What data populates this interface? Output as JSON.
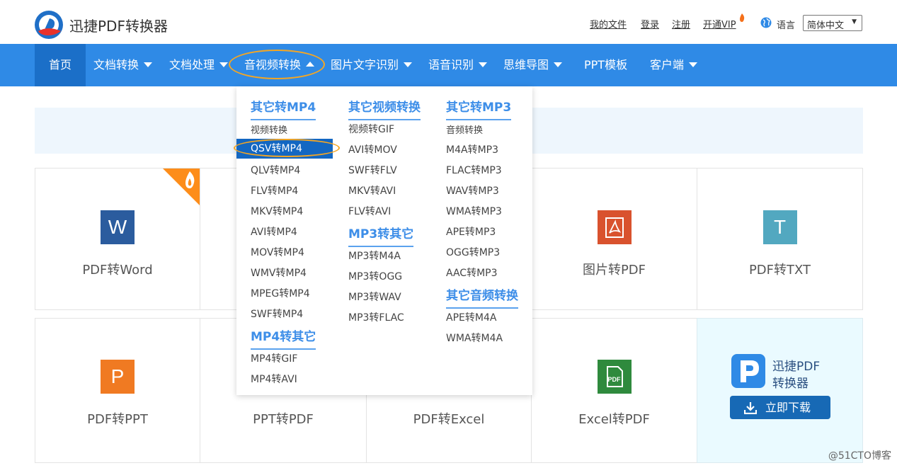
{
  "header": {
    "brand": "迅捷PDF转换器",
    "links": [
      "我的文件",
      "登录",
      "注册",
      "开通VIP"
    ],
    "lang_label": "语言",
    "lang_value": "简体中文"
  },
  "nav": {
    "items": [
      "首页",
      "文档转换",
      "文档处理",
      "音视频转换",
      "图片文字识别",
      "语音识别",
      "思维导图",
      "PPT模板",
      "客户端"
    ]
  },
  "dropdown": {
    "col1": {
      "title1": "其它转MP4",
      "items1": [
        "视频转换",
        "QSV转MP4",
        "QLV转MP4",
        "FLV转MP4",
        "MKV转MP4",
        "AVI转MP4",
        "MOV转MP4",
        "WMV转MP4",
        "MPEG转MP4",
        "SWF转MP4"
      ],
      "title2": "MP4转其它",
      "items2": [
        "MP4转GIF",
        "MP4转AVI"
      ]
    },
    "col2": {
      "title1": "其它视频转换",
      "items1": [
        "视频转GIF",
        "AVI转MOV",
        "SWF转FLV",
        "MKV转AVI",
        "FLV转AVI"
      ],
      "title2": "MP3转其它",
      "items2": [
        "MP3转M4A",
        "MP3转OGG",
        "MP3转WAV",
        "MP3转FLAC"
      ]
    },
    "col3": {
      "title1": "其它转MP3",
      "items1": [
        "音频转换",
        "M4A转MP3",
        "FLAC转MP3",
        "WAV转MP3",
        "WMA转MP3",
        "APE转MP3",
        "OGG转MP3",
        "AAC转MP3"
      ],
      "title2": "其它音频转换",
      "items2": [
        "APE转M4A",
        "WMA转M4A"
      ]
    }
  },
  "cards": {
    "row1": [
      {
        "icon": "W",
        "label": "PDF转Word",
        "color": "#2b5c9e"
      },
      {
        "icon": "",
        "label": "",
        "color": ""
      },
      {
        "icon": "",
        "label": "",
        "color": ""
      },
      {
        "icon": "pdf-acrobat-icon",
        "label": "图片转PDF",
        "color": "#d9522e"
      },
      {
        "icon": "T",
        "label": "PDF转TXT",
        "color": "#52a8c0"
      }
    ],
    "row2": [
      {
        "icon": "P",
        "label": "PDF转PPT",
        "color": "#f07a22"
      },
      {
        "icon": "",
        "label": "PPT转PDF",
        "color": ""
      },
      {
        "icon": "",
        "label": "PDF转Excel",
        "color": ""
      },
      {
        "icon": "PDF",
        "label": "Excel转PDF",
        "color": "#2f8a3d"
      }
    ]
  },
  "download": {
    "line1": "迅捷PDF",
    "line2": "转换器",
    "button": "立即下载"
  },
  "watermark": "@51CTO博客"
}
